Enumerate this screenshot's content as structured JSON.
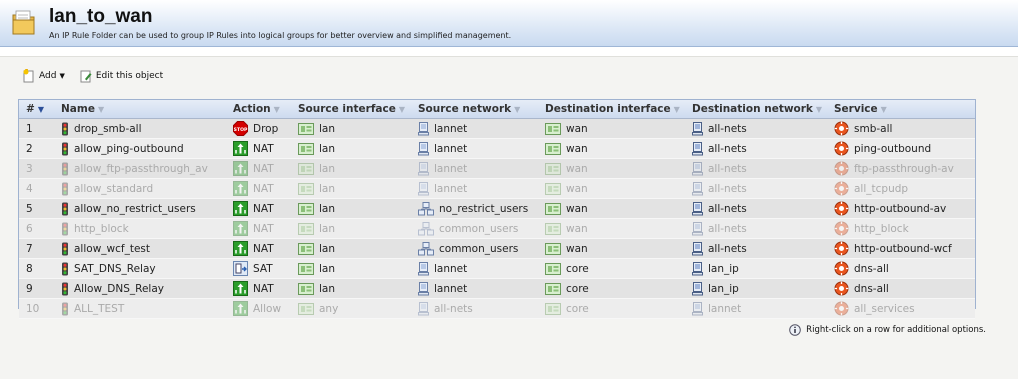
{
  "header": {
    "title": "lan_to_wan",
    "subtitle": "An IP Rule Folder can be used to group IP Rules into logical groups for better overview and simplified management."
  },
  "toolbar": {
    "add_label": "Add",
    "edit_label": "Edit this object"
  },
  "grid": {
    "columns": [
      "#",
      "Name",
      "Action",
      "Source interface",
      "Source network",
      "Destination interface",
      "Destination network",
      "Service"
    ],
    "rows": [
      {
        "num": "1",
        "name": "drop_smb-all",
        "action": "Drop",
        "action_icon": "stop",
        "src_if": "lan",
        "src_net": "lannet",
        "src_net_icon": "host",
        "dst_if": "wan",
        "dst_net": "all-nets",
        "service": "smb-all",
        "disabled": false
      },
      {
        "num": "2",
        "name": "allow_ping-outbound",
        "action": "NAT",
        "action_icon": "nat",
        "src_if": "lan",
        "src_net": "lannet",
        "src_net_icon": "host",
        "dst_if": "wan",
        "dst_net": "all-nets",
        "service": "ping-outbound",
        "disabled": false
      },
      {
        "num": "3",
        "name": "allow_ftp-passthrough_av",
        "action": "NAT",
        "action_icon": "nat",
        "src_if": "lan",
        "src_net": "lannet",
        "src_net_icon": "host",
        "dst_if": "wan",
        "dst_net": "all-nets",
        "service": "ftp-passthrough-av",
        "disabled": true
      },
      {
        "num": "4",
        "name": "allow_standard",
        "action": "NAT",
        "action_icon": "nat",
        "src_if": "lan",
        "src_net": "lannet",
        "src_net_icon": "host",
        "dst_if": "wan",
        "dst_net": "all-nets",
        "service": "all_tcpudp",
        "disabled": true
      },
      {
        "num": "5",
        "name": "allow_no_restrict_users",
        "action": "NAT",
        "action_icon": "nat",
        "src_if": "lan",
        "src_net": "no_restrict_users",
        "src_net_icon": "group",
        "dst_if": "wan",
        "dst_net": "all-nets",
        "service": "http-outbound-av",
        "disabled": false
      },
      {
        "num": "6",
        "name": "http_block",
        "action": "NAT",
        "action_icon": "nat",
        "src_if": "lan",
        "src_net": "common_users",
        "src_net_icon": "group",
        "dst_if": "wan",
        "dst_net": "all-nets",
        "service": "http_block",
        "disabled": true
      },
      {
        "num": "7",
        "name": "allow_wcf_test",
        "action": "NAT",
        "action_icon": "nat",
        "src_if": "lan",
        "src_net": "common_users",
        "src_net_icon": "group",
        "dst_if": "wan",
        "dst_net": "all-nets",
        "service": "http-outbound-wcf",
        "disabled": false
      },
      {
        "num": "8",
        "name": "SAT_DNS_Relay",
        "action": "SAT",
        "action_icon": "sat",
        "src_if": "lan",
        "src_net": "lannet",
        "src_net_icon": "host",
        "dst_if": "core",
        "dst_net": "lan_ip",
        "service": "dns-all",
        "disabled": false
      },
      {
        "num": "9",
        "name": "Allow_DNS_Relay",
        "action": "NAT",
        "action_icon": "nat",
        "src_if": "lan",
        "src_net": "lannet",
        "src_net_icon": "host",
        "dst_if": "core",
        "dst_net": "lan_ip",
        "service": "dns-all",
        "disabled": false
      },
      {
        "num": "10",
        "name": "ALL_TEST",
        "action": "Allow",
        "action_icon": "nat",
        "src_if": "any",
        "src_net": "all-nets",
        "src_net_icon": "host",
        "dst_if": "core",
        "dst_net": "lannet",
        "service": "all_services",
        "disabled": true
      }
    ]
  },
  "footer": {
    "hint": "Right-click on a row for additional options."
  },
  "colors": {
    "header_bg": "#dde8f6",
    "grid_border": "#9fb2d0",
    "stop_red": "#d40000",
    "nat_green": "#2a9d2a",
    "disabled_text": "#aaaaaa"
  }
}
